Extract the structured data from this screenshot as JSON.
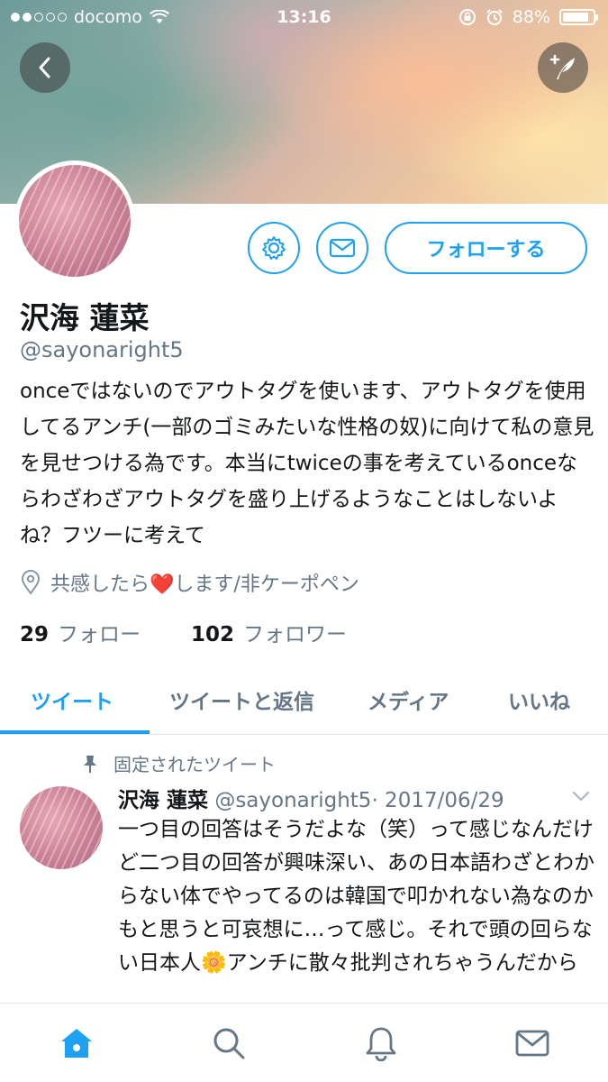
{
  "status_bar": {
    "carrier": "docomo",
    "time": "13:16",
    "battery": "88%",
    "battery_level": 0.88
  },
  "header": {
    "back_icon": "chevron-left-icon",
    "compose_icon": "compose-feather-icon"
  },
  "profile": {
    "name": "沢海 蓮菜",
    "handle": "@sayonaright5",
    "bio": "onceではないのでアウトタグを使います、アウトタグを使用してるアンチ(一部のゴミみたいな性格の奴)に向けて私の意見を見せつける為です。本当にtwiceの事を考えているonceならわざわざアウトタグを盛り上げるようなことはしないよね？フツーに考えて",
    "location_before": "共感したら",
    "location_emoji": "❤️",
    "location_after": "します/非ケーポペン",
    "following_count": "29",
    "following_label": "フォロー",
    "followers_count": "102",
    "followers_label": "フォロワー",
    "follow_button": "フォローする"
  },
  "tabs": [
    {
      "label": "ツイート",
      "active": true
    },
    {
      "label": "ツイートと返信",
      "active": false
    },
    {
      "label": "メディア",
      "active": false
    },
    {
      "label": "いいね",
      "active": false
    }
  ],
  "pinned_tweet": {
    "pinned_label": "固定されたツイート",
    "name": "沢海 蓮菜",
    "handle": "@sayonaright5",
    "date": "· 2017/06/29",
    "text_line1": "一つ目の回答はそうだよな（笑）って感じなんだけど二つ目の回答が興味深い、あの日本語わざとわからない体でやってるのは韓国で叩かれない為なのかもと思うと可哀想に…って感じ。それで頭の回らない日本人",
    "text_emoji": "🌼",
    "text_line2": "アンチに散々批判されちゃうんだから"
  },
  "colors": {
    "accent": "#1da1f2",
    "secondary_text": "#657786"
  },
  "bottom_nav": [
    "home-icon",
    "search-icon",
    "notifications-bell-icon",
    "messages-envelope-icon"
  ]
}
